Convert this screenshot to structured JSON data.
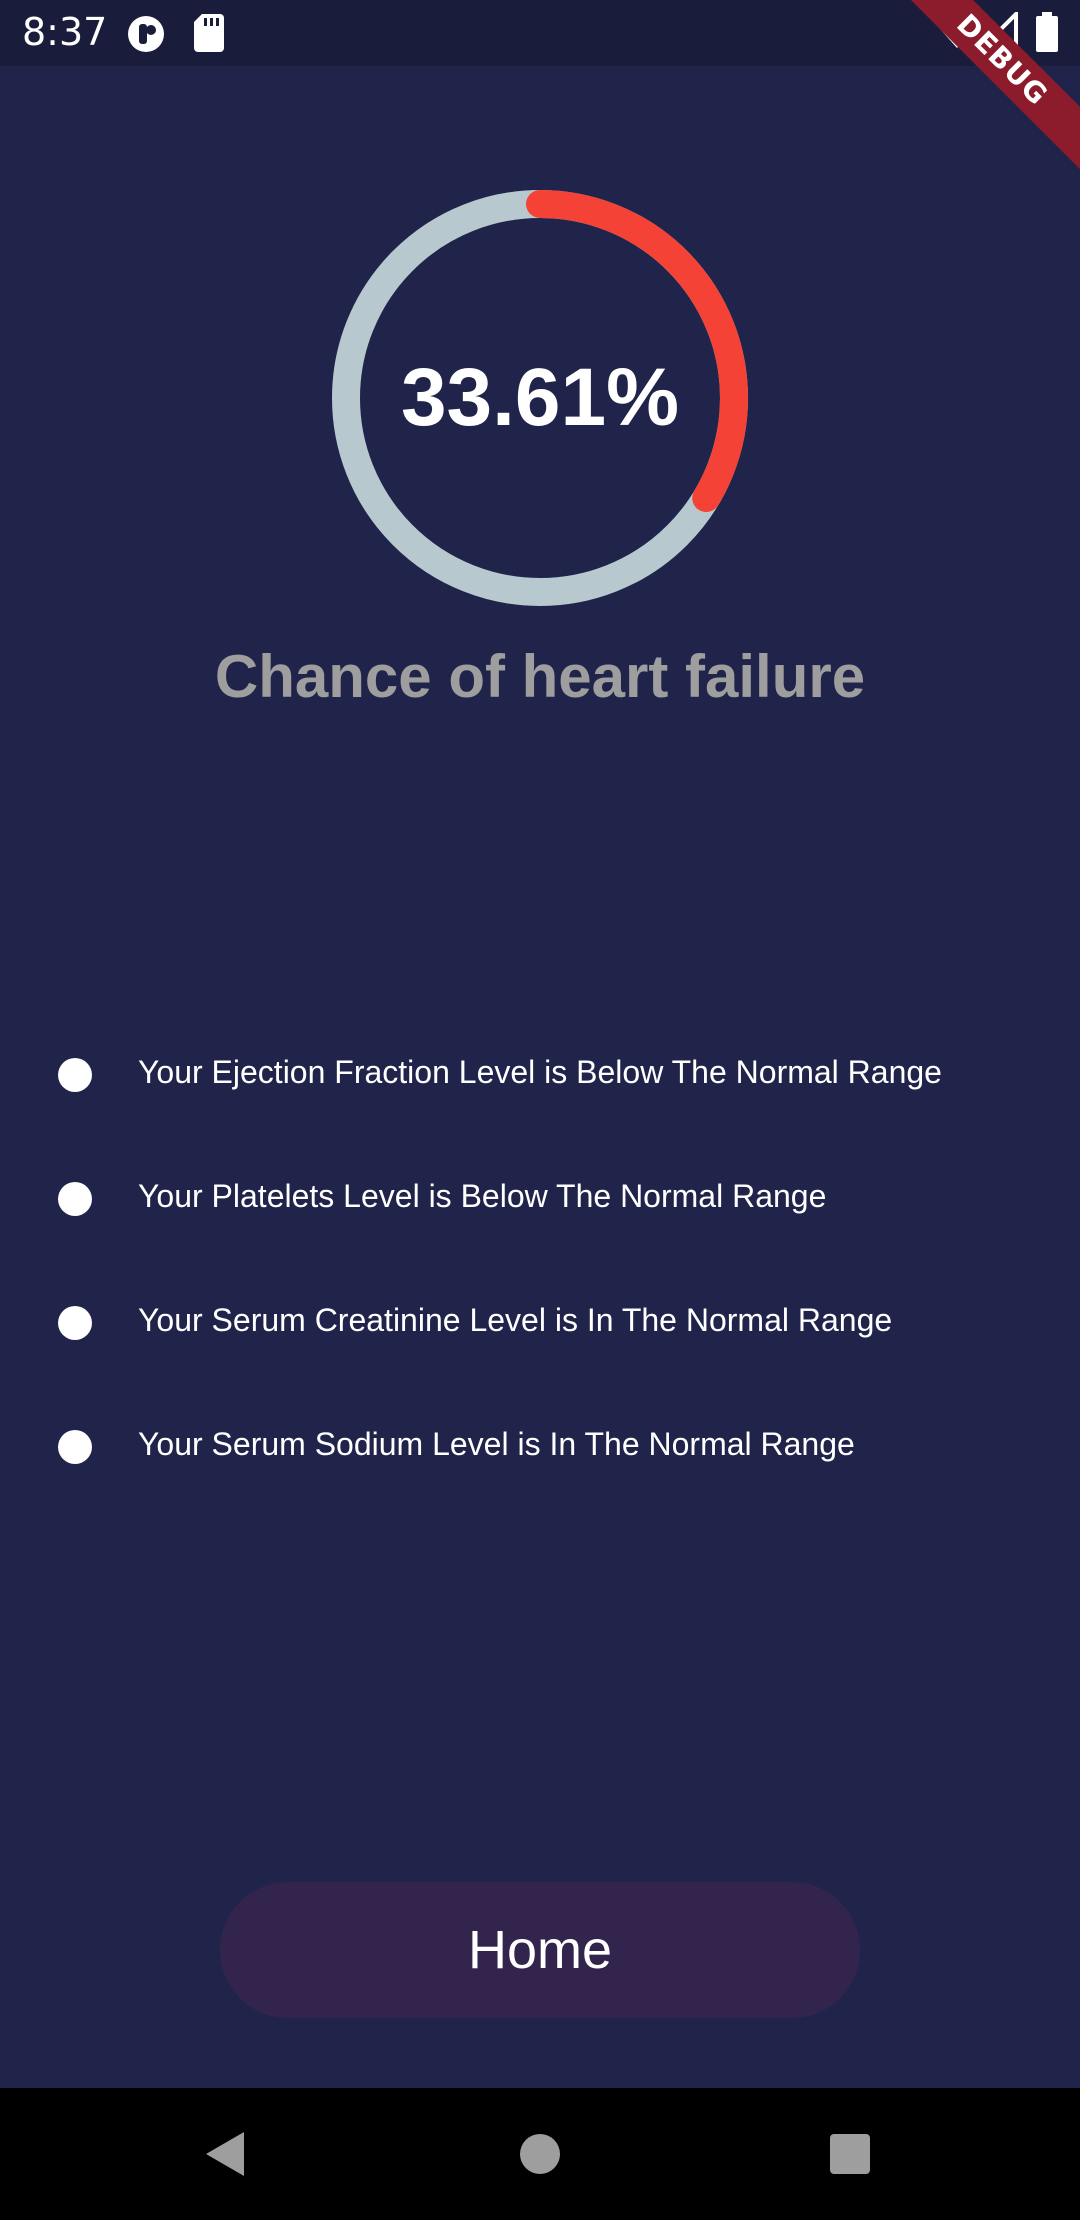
{
  "status_bar": {
    "time": "8:37",
    "left_icons": [
      "app-notification-icon",
      "sd-card-icon"
    ],
    "right_icons": [
      "wifi-icon",
      "cell-signal-icon",
      "battery-icon"
    ]
  },
  "debug_banner": {
    "label": "DEBUG",
    "color": "#8c1c2b"
  },
  "result": {
    "value_label": "33.61%",
    "progress": 0.3361,
    "caption": "Chance of heart failure",
    "progress_color": "#f44336",
    "track_color": "#b8c8cf"
  },
  "findings": [
    {
      "text": "Your Ejection Fraction Level is Below The Normal Range"
    },
    {
      "text": "Your Platelets Level is Below The Normal Range"
    },
    {
      "text": "Your Serum Creatinine Level is In The Normal Range"
    },
    {
      "text": "Your Serum Sodium Level is In The Normal Range"
    }
  ],
  "home_button": {
    "label": "Home"
  },
  "navigation": {
    "buttons": [
      "back-icon",
      "home-circle-icon",
      "recents-square-icon"
    ]
  },
  "colors": {
    "background": "#21244a",
    "button": "#33244e",
    "caption": "#9e9e9e"
  }
}
